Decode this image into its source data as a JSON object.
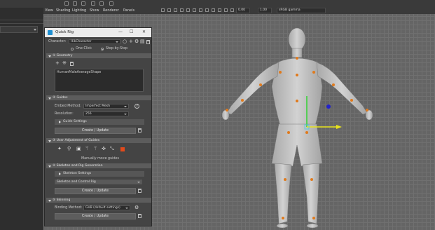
{
  "viewport_menu": [
    "View",
    "Shading",
    "Lighting",
    "Show",
    "Renderer",
    "Panels"
  ],
  "viewport_fields": {
    "value_a": "0.00",
    "value_b": "1.00",
    "camera": "sRGB gamma"
  },
  "window": {
    "title": "Quick Rig",
    "logo": "maya-icon"
  },
  "character": {
    "label": "Character:",
    "value": "HikCharacter"
  },
  "mode": {
    "one_click": "One-Click",
    "step_by_step": "Step-by-Step",
    "selected": "step_by_step"
  },
  "sections": {
    "geometry": "① Geometry",
    "guides": "② Guides",
    "user_adjustment": "③ User Adjustment of Guides",
    "skeleton": "④ Skeleton and Rig Generation",
    "skinning": "⑤ Skinning"
  },
  "geometry": {
    "mesh": "HumanMaleAverageShape"
  },
  "guides": {
    "embed_method_label": "Embed Method:",
    "embed_method_value": "Imperfect Mesh",
    "resolution_label": "Resolution:",
    "resolution_value": "256",
    "guide_settings": "Guide Settings",
    "create_update": "Create / Update"
  },
  "adjustment": {
    "caption": "Manually move guides"
  },
  "skeleton": {
    "skeleton_settings": "Skeleton Settings",
    "rig_option": "Skeleton and Control Rig",
    "create_update": "Create / Update"
  },
  "skinning": {
    "binding_label": "Binding Method:",
    "binding_value": "GVB (default settings)",
    "create_update": "Create / Update"
  },
  "colors": {
    "accent_blue": "#1f6fb5",
    "joint_orange": "#e07a1c",
    "manip_green": "#3cd23c",
    "manip_yellow": "#e8e31c",
    "manip_blue": "#2222cc",
    "panel_bg": "#444444"
  }
}
